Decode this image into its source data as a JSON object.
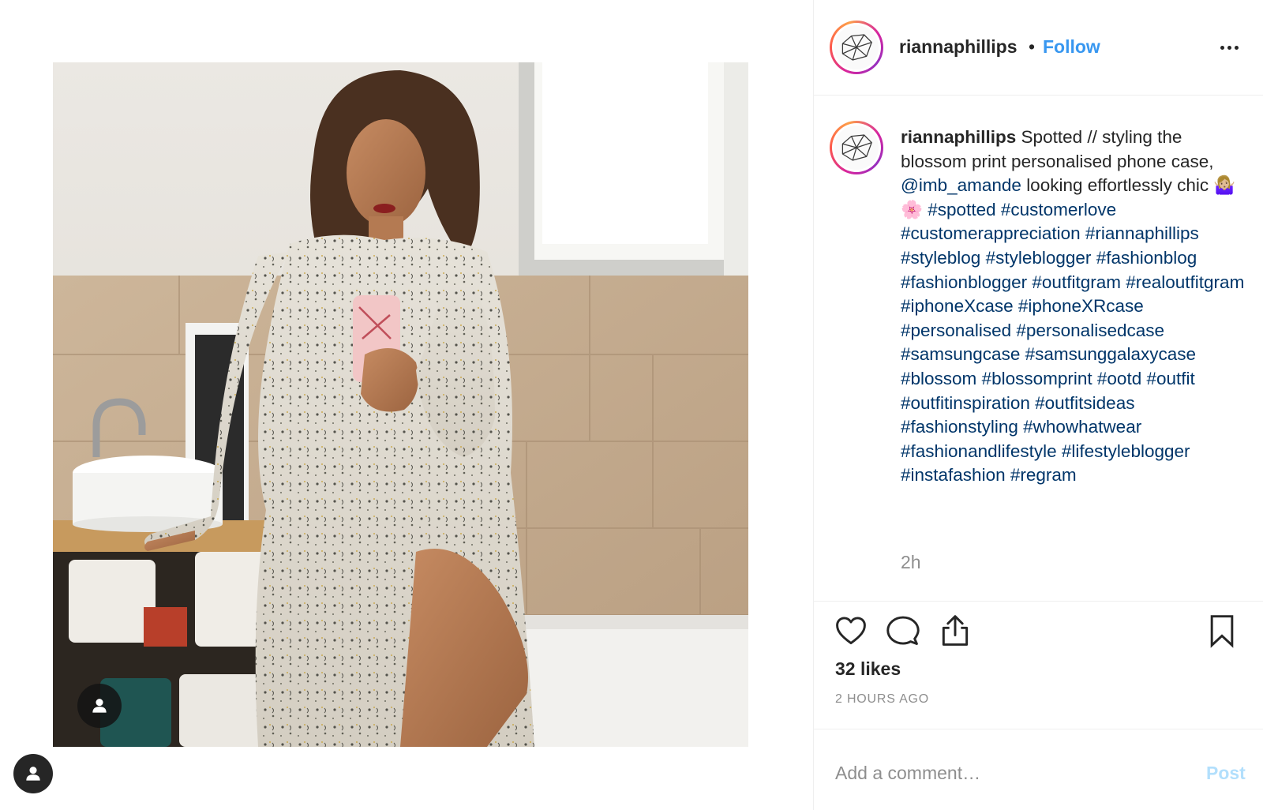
{
  "post": {
    "username": "riannaphillips",
    "header_separator": "•",
    "follow_label": "Follow",
    "caption": {
      "username": "riannaphillips",
      "text_before_mention": "Spotted // styling the blossom print personalised phone case,",
      "mention": "@imb_amande",
      "text_after_mention": "looking effortlessly chic",
      "emoji": "🤷🏼‍♀️ 🌸",
      "hashtags": [
        "#spotted",
        "#customerlove",
        "#customerappreciation",
        "#riannaphillips",
        "#styleblog",
        "#styleblogger",
        "#fashionblog",
        "#fashionblogger",
        "#outfitgram",
        "#realoutfitgram",
        "#iphoneXcase",
        "#iphoneXRcase",
        "#personalised",
        "#personalisedcase",
        "#samsungcase",
        "#samsunggalaxycase",
        "#blossom",
        "#blossomprint",
        "#ootd",
        "#outfit",
        "#outfitinspiration",
        "#outfitsideas",
        "#fashionstyling",
        "#whowhatwear",
        "#fashionandlifestyle",
        "#lifestyleblogger",
        "#instafashion",
        "#regram"
      ]
    },
    "caption_age": "2h",
    "likes": "32 likes",
    "posted_ago": "2 HOURS AGO",
    "comment_placeholder": "Add a comment…",
    "post_button_label": "Post"
  },
  "icons": {
    "avatar": "geometric-diamond-logo-icon",
    "more": "more-options-icon",
    "like": "heart-icon",
    "comment": "comment-bubble-icon",
    "share": "share-icon",
    "save": "bookmark-icon",
    "tag": "user-tag-icon"
  },
  "colors": {
    "link": "#3897f0",
    "hashtag": "#003569",
    "muted": "#8e8e8e",
    "post_disabled": "#b2dffc"
  }
}
